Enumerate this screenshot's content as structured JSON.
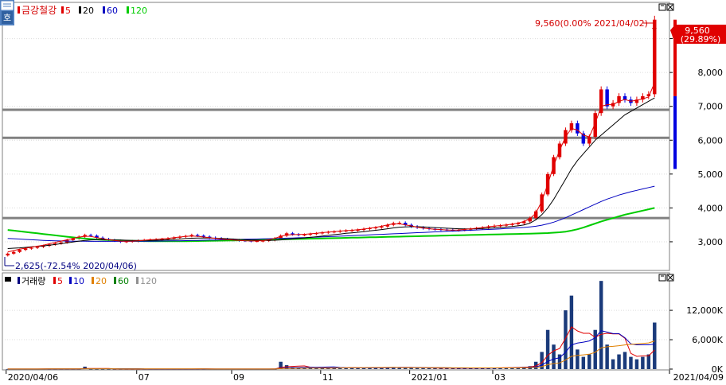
{
  "chart_data": [
    {
      "type": "candlestick",
      "stock_name": "금강철강",
      "legend": [
        {
          "label": "5",
          "color": "#e00000"
        },
        {
          "label": "20",
          "color": "#000000"
        },
        {
          "label": "60",
          "color": "#0000c0"
        },
        {
          "label": "120",
          "color": "#00cc00"
        }
      ],
      "y_ticks": [
        "3,000",
        "4,000",
        "5,000",
        "6,000",
        "7,000",
        "8,000",
        "9,000"
      ],
      "y_tick_values": [
        3000,
        4000,
        5000,
        6000,
        7000,
        8000,
        9000
      ],
      "ylim": [
        2200,
        10000
      ],
      "high_annotation": "9,560(0.00% 2021/04/02)",
      "low_annotation": "2,625(-72.54% 2020/04/06)",
      "current_price": "9,560",
      "current_change": "(29.89%)",
      "horizontal_lines": [
        6900,
        6070,
        3700
      ],
      "close_series": [
        2650,
        2700,
        2760,
        2800,
        2820,
        2850,
        2880,
        2920,
        2950,
        2980,
        3050,
        3100,
        3150,
        3200,
        3180,
        3120,
        3080,
        3050,
        3030,
        3000,
        3010,
        3020,
        3030,
        3050,
        3060,
        3070,
        3080,
        3100,
        3120,
        3150,
        3170,
        3200,
        3180,
        3150,
        3120,
        3100,
        3080,
        3060,
        3050,
        3040,
        3030,
        3020,
        3020,
        3030,
        3050,
        3100,
        3180,
        3250,
        3220,
        3200,
        3210,
        3230,
        3250,
        3270,
        3290,
        3300,
        3320,
        3330,
        3340,
        3350,
        3380,
        3400,
        3420,
        3450,
        3500,
        3550,
        3560,
        3500,
        3450,
        3420,
        3400,
        3380,
        3370,
        3360,
        3350,
        3340,
        3350,
        3360,
        3380,
        3400,
        3420,
        3450,
        3470,
        3480,
        3500,
        3520,
        3550,
        3600,
        3700,
        3900,
        4400,
        5000,
        5500,
        5900,
        6300,
        6500,
        6200,
        5900,
        6100,
        6800,
        7500,
        7000,
        7100,
        7300,
        7200,
        7100,
        7200,
        7300,
        7360,
        9560
      ],
      "ma5": [
        2700,
        2740,
        2780,
        2810,
        2840,
        2870,
        2900,
        2940,
        2980,
        3020,
        3060,
        3100,
        3140,
        3160,
        3160,
        3120,
        3090,
        3060,
        3040,
        3020,
        3015,
        3020,
        3030,
        3045,
        3060,
        3070,
        3085,
        3100,
        3120,
        3140,
        3160,
        3170,
        3160,
        3140,
        3120,
        3100,
        3080,
        3065,
        3050,
        3040,
        3030,
        3025,
        3025,
        3035,
        3060,
        3100,
        3160,
        3200,
        3210,
        3215,
        3220,
        3235,
        3250,
        3270,
        3285,
        3300,
        3315,
        3330,
        3340,
        3355,
        3375,
        3400,
        3425,
        3460,
        3500,
        3530,
        3530,
        3500,
        3470,
        3430,
        3405,
        3385,
        3370,
        3360,
        3350,
        3345,
        3350,
        3365,
        3380,
        3400,
        3420,
        3445,
        3465,
        3480,
        3500,
        3520,
        3550,
        3600,
        3680,
        3850,
        4200,
        4700,
        5250,
        5700,
        6100,
        6350,
        6300,
        6150,
        6100,
        6500,
        7000,
        7050,
        7050,
        7150,
        7200,
        7150,
        7180,
        7220,
        7280,
        7700
      ],
      "ma20": [
        2800,
        2810,
        2820,
        2835,
        2850,
        2865,
        2880,
        2900,
        2920,
        2945,
        2970,
        2995,
        3020,
        3040,
        3055,
        3060,
        3060,
        3060,
        3055,
        3050,
        3045,
        3040,
        3040,
        3040,
        3040,
        3045,
        3050,
        3060,
        3070,
        3080,
        3095,
        3105,
        3110,
        3110,
        3110,
        3105,
        3100,
        3090,
        3080,
        3070,
        3060,
        3050,
        3045,
        3040,
        3040,
        3045,
        3055,
        3070,
        3085,
        3100,
        3115,
        3130,
        3150,
        3170,
        3190,
        3210,
        3230,
        3250,
        3265,
        3280,
        3300,
        3320,
        3340,
        3360,
        3385,
        3410,
        3430,
        3440,
        3445,
        3445,
        3440,
        3430,
        3420,
        3410,
        3400,
        3390,
        3385,
        3380,
        3380,
        3385,
        3390,
        3400,
        3410,
        3420,
        3435,
        3450,
        3470,
        3500,
        3550,
        3650,
        3800,
        4000,
        4250,
        4550,
        4850,
        5150,
        5400,
        5600,
        5800,
        6000,
        6150,
        6300,
        6450,
        6600,
        6750,
        6850,
        6950,
        7050,
        7150,
        7250
      ],
      "ma60": [
        3100,
        3090,
        3080,
        3070,
        3060,
        3050,
        3040,
        3035,
        3030,
        3025,
        3020,
        3018,
        3016,
        3015,
        3014,
        3014,
        3013,
        3013,
        3013,
        3013,
        3013,
        3014,
        3015,
        3016,
        3018,
        3020,
        3022,
        3025,
        3028,
        3030,
        3034,
        3038,
        3042,
        3046,
        3050,
        3054,
        3058,
        3062,
        3066,
        3070,
        3074,
        3078,
        3082,
        3086,
        3090,
        3095,
        3100,
        3106,
        3112,
        3118,
        3124,
        3130,
        3137,
        3144,
        3151,
        3158,
        3165,
        3172,
        3180,
        3188,
        3196,
        3204,
        3212,
        3220,
        3228,
        3236,
        3244,
        3252,
        3260,
        3268,
        3276,
        3284,
        3292,
        3300,
        3308,
        3316,
        3324,
        3332,
        3340,
        3348,
        3356,
        3364,
        3372,
        3380,
        3390,
        3400,
        3412,
        3425,
        3440,
        3460,
        3490,
        3530,
        3580,
        3640,
        3710,
        3790,
        3870,
        3950,
        4030,
        4110,
        4190,
        4260,
        4320,
        4380,
        4430,
        4480,
        4520,
        4560,
        4600,
        4640
      ],
      "ma120": [
        3350,
        3330,
        3310,
        3290,
        3270,
        3250,
        3230,
        3210,
        3190,
        3170,
        3150,
        3130,
        3110,
        3095,
        3080,
        3070,
        3060,
        3052,
        3045,
        3038,
        3032,
        3027,
        3023,
        3020,
        3018,
        3017,
        3016,
        3016,
        3016,
        3017,
        3018,
        3020,
        3022,
        3025,
        3028,
        3031,
        3034,
        3037,
        3040,
        3044,
        3048,
        3052,
        3056,
        3060,
        3064,
        3068,
        3072,
        3076,
        3080,
        3084,
        3088,
        3092,
        3096,
        3100,
        3104,
        3108,
        3112,
        3116,
        3120,
        3124,
        3128,
        3132,
        3136,
        3140,
        3144,
        3148,
        3152,
        3156,
        3160,
        3164,
        3168,
        3172,
        3176,
        3180,
        3184,
        3188,
        3192,
        3196,
        3200,
        3204,
        3208,
        3212,
        3216,
        3220,
        3224,
        3228,
        3232,
        3236,
        3240,
        3245,
        3250,
        3258,
        3268,
        3280,
        3300,
        3330,
        3370,
        3420,
        3480,
        3540,
        3600,
        3650,
        3700,
        3750,
        3800,
        3840,
        3880,
        3920,
        3960,
        4000
      ]
    },
    {
      "type": "bar",
      "title": "거래량",
      "legend": [
        {
          "label": "5",
          "color": "#e00000"
        },
        {
          "label": "10",
          "color": "#0000c0"
        },
        {
          "label": "20",
          "color": "#e08000"
        },
        {
          "label": "60",
          "color": "#008000"
        },
        {
          "label": "120",
          "color": "#909090"
        }
      ],
      "y_ticks": [
        "0K",
        "6,000K",
        "12,000K"
      ],
      "y_tick_values": [
        0,
        6000,
        12000
      ],
      "ylim": [
        0,
        19000
      ],
      "x_ticks": [
        "2020/04/06",
        "07",
        "09",
        "11",
        "2021/01",
        "03",
        "2021/04/09"
      ],
      "volume_series": [
        20,
        15,
        18,
        20,
        25,
        30,
        40,
        60,
        50,
        40,
        30,
        35,
        30,
        500,
        60,
        40,
        30,
        25,
        20,
        20,
        18,
        15,
        18,
        20,
        25,
        30,
        25,
        20,
        20,
        22,
        25,
        30,
        25,
        22,
        20,
        18,
        16,
        15,
        15,
        14,
        14,
        15,
        15,
        18,
        20,
        60,
        1500,
        800,
        400,
        300,
        250,
        220,
        200,
        220,
        250,
        260,
        280,
        300,
        260,
        240,
        250,
        260,
        280,
        300,
        350,
        400,
        380,
        300,
        260,
        240,
        220,
        210,
        200,
        190,
        180,
        175,
        180,
        190,
        200,
        220,
        240,
        260,
        280,
        300,
        320,
        340,
        380,
        450,
        600,
        1500,
        3500,
        8000,
        5000,
        3000,
        12000,
        15000,
        4000,
        2500,
        3000,
        8000,
        18000,
        5000,
        2000,
        3000,
        3500,
        2500,
        2000,
        2500,
        3000,
        9500
      ]
    }
  ]
}
